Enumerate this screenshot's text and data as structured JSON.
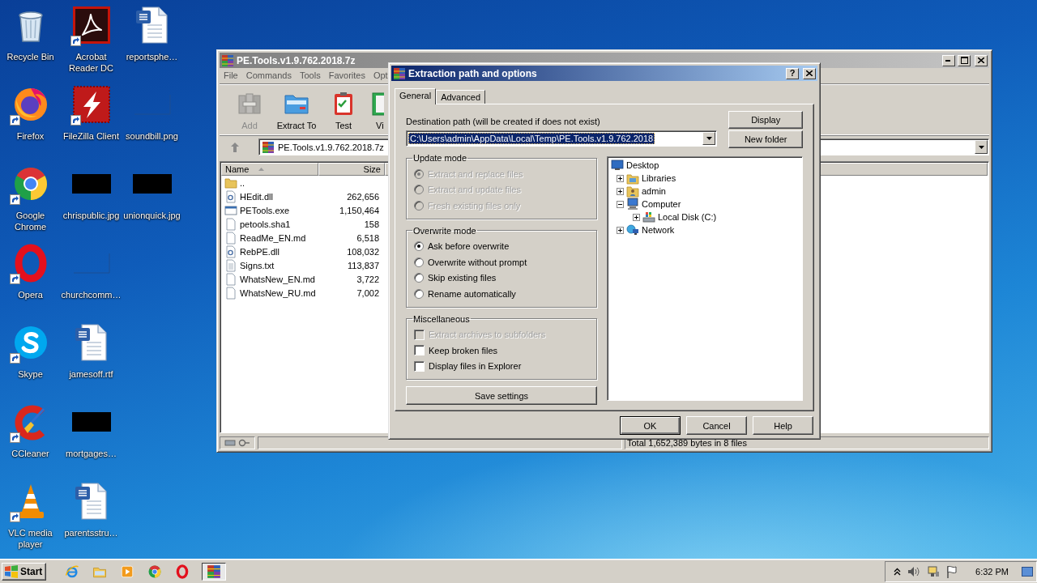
{
  "desktop": {
    "icon_columns": [
      {
        "icons": [
          {
            "label": "Recycle Bin",
            "kind": "recycle-bin",
            "shortcut": false
          },
          {
            "label": "Firefox",
            "kind": "firefox",
            "shortcut": true
          },
          {
            "label": "Google Chrome",
            "kind": "chrome",
            "shortcut": true
          },
          {
            "label": "Opera",
            "kind": "opera",
            "shortcut": true
          },
          {
            "label": "Skype",
            "kind": "skype",
            "shortcut": true
          },
          {
            "label": "CCleaner",
            "kind": "ccleaner",
            "shortcut": true
          },
          {
            "label": "VLC media player",
            "kind": "vlc",
            "shortcut": true
          }
        ]
      },
      {
        "icons": [
          {
            "label": "Acrobat Reader DC",
            "kind": "pdf-reader",
            "shortcut": true
          },
          {
            "label": "FileZilla Client",
            "kind": "filezilla",
            "shortcut": true
          },
          {
            "label": "chrispublic.jpg",
            "kind": "dark-image",
            "shortcut": false
          },
          {
            "label": "churchcomm…",
            "kind": "blank-image",
            "shortcut": false
          },
          {
            "label": "jamesoff.rtf",
            "kind": "word-doc",
            "shortcut": false
          },
          {
            "label": "mortgages…",
            "kind": "dark-image",
            "shortcut": false
          },
          {
            "label": "parentsstru…",
            "kind": "word-doc",
            "shortcut": false
          }
        ]
      },
      {
        "icons": [
          {
            "label": "reportsphe…",
            "kind": "word-doc",
            "shortcut": false
          },
          {
            "label": "soundbill.png",
            "kind": "blank-image",
            "shortcut": false
          },
          {
            "label": "unionquick.jpg",
            "kind": "dark-image",
            "shortcut": false
          }
        ]
      }
    ]
  },
  "archive_window": {
    "title": "PE.Tools.v1.9.762.2018.7z",
    "menu": [
      "File",
      "Commands",
      "Tools",
      "Favorites",
      "Opt"
    ],
    "toolbar": [
      {
        "label": "Add",
        "kind": "add",
        "disabled": true
      },
      {
        "label": "Extract To",
        "kind": "extract",
        "disabled": false
      },
      {
        "label": "Test",
        "kind": "test",
        "disabled": false
      },
      {
        "label": "Vi",
        "kind": "view",
        "disabled": false
      }
    ],
    "path": "PE.Tools.v1.9.762.2018.7z",
    "columns": [
      {
        "label": "Name",
        "sorted": true
      },
      {
        "label": "Size",
        "sorted": false
      }
    ],
    "files": [
      {
        "name": "..",
        "kind": "folder"
      },
      {
        "name": "HEdit.dll",
        "size": "262,656",
        "kind": "dll"
      },
      {
        "name": "PETools.exe",
        "size": "1,150,464",
        "kind": "exe"
      },
      {
        "name": "petools.sha1",
        "size": "158",
        "kind": "file"
      },
      {
        "name": "ReadMe_EN.md",
        "size": "6,518",
        "kind": "file"
      },
      {
        "name": "RebPE.dll",
        "size": "108,032",
        "kind": "dll"
      },
      {
        "name": "Signs.txt",
        "size": "113,837",
        "kind": "text"
      },
      {
        "name": "WhatsNew_EN.md",
        "size": "3,722",
        "kind": "file"
      },
      {
        "name": "WhatsNew_RU.md",
        "size": "7,002",
        "kind": "file"
      }
    ],
    "status": "Total 1,652,389 bytes in 8 files"
  },
  "dialog": {
    "title": "Extraction path and options",
    "help_button": "?",
    "tabs": [
      {
        "label": "General",
        "selected": true
      },
      {
        "label": "Advanced",
        "selected": false
      }
    ],
    "destination_label": "Destination path (will be created if does not exist)",
    "destination_path": "C:\\Users\\admin\\AppData\\Local\\Temp\\PE.Tools.v1.9.762.2018",
    "side_buttons": [
      "Display",
      "New folder"
    ],
    "groups": [
      {
        "title": "Update mode",
        "kind": "radio",
        "options": [
          {
            "label": "Extract and replace files",
            "checked": true,
            "disabled": true
          },
          {
            "label": "Extract and update files",
            "checked": false,
            "disabled": true
          },
          {
            "label": "Fresh existing files only",
            "checked": false,
            "disabled": true
          }
        ]
      },
      {
        "title": "Overwrite mode",
        "kind": "radio",
        "options": [
          {
            "label": "Ask before overwrite",
            "checked": true,
            "disabled": false
          },
          {
            "label": "Overwrite without prompt",
            "checked": false,
            "disabled": false
          },
          {
            "label": "Skip existing files",
            "checked": false,
            "disabled": false
          },
          {
            "label": "Rename automatically",
            "checked": false,
            "disabled": false
          }
        ]
      },
      {
        "title": "Miscellaneous",
        "kind": "checkbox",
        "options": [
          {
            "label": "Extract archives to subfolders",
            "checked": false,
            "disabled": true
          },
          {
            "label": "Keep broken files",
            "checked": false,
            "disabled": false
          },
          {
            "label": "Display files in Explorer",
            "checked": false,
            "disabled": false
          }
        ]
      }
    ],
    "save_button": "Save settings",
    "tree": [
      {
        "label": "Desktop",
        "kind": "desktop",
        "children": [
          {
            "label": "Libraries",
            "kind": "libraries",
            "expanded": false
          },
          {
            "label": "admin",
            "kind": "user-folder",
            "expanded": false
          },
          {
            "label": "Computer",
            "kind": "computer",
            "expanded": true,
            "children": [
              {
                "label": "Local Disk (C:)",
                "kind": "drive",
                "expanded": false
              }
            ]
          },
          {
            "label": "Network",
            "kind": "network",
            "expanded": false
          }
        ]
      }
    ],
    "buttons": [
      {
        "label": "OK",
        "default": true
      },
      {
        "label": "Cancel",
        "default": false
      },
      {
        "label": "Help",
        "default": false
      }
    ]
  },
  "taskbar": {
    "start": "Start",
    "apps": [
      {
        "kind": "ie",
        "active": false
      },
      {
        "kind": "explorer",
        "active": false
      },
      {
        "kind": "media-player",
        "active": false
      },
      {
        "kind": "chrome",
        "active": false
      },
      {
        "kind": "opera",
        "active": false
      },
      {
        "kind": "winrar",
        "active": true
      }
    ],
    "clock": "6:32 PM"
  }
}
